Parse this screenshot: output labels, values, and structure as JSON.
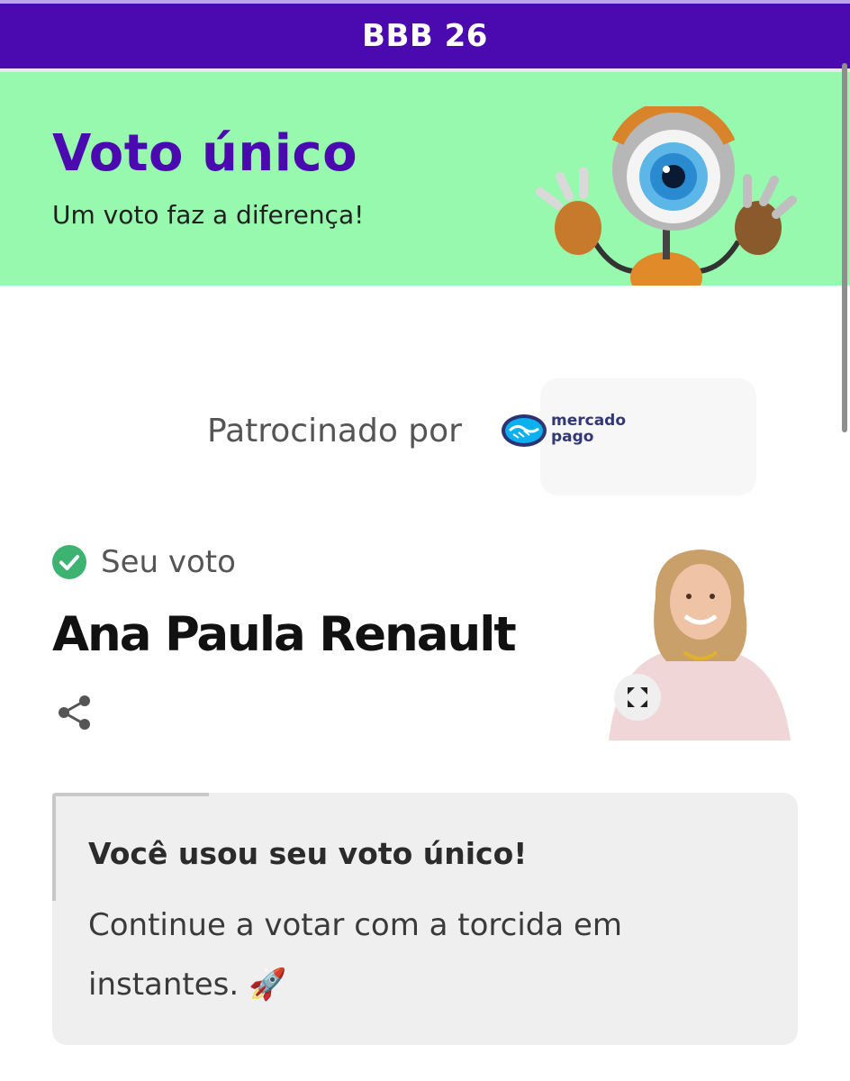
{
  "header": {
    "title": "BBB 26"
  },
  "banner": {
    "title": "Voto único",
    "subtitle": "Um voto faz a diferença!",
    "mascot_icon": "big-brother-eye-mascot"
  },
  "sponsor": {
    "label": "Patrocinado por",
    "logo_line1": "mercado",
    "logo_line2": "pago"
  },
  "vote": {
    "status_label": "Seu voto",
    "candidate_name": "Ana Paula Renault",
    "share_icon": "share-icon",
    "expand_icon": "expand-icon"
  },
  "notice": {
    "title": "Você usou seu voto único!",
    "body": "Continue a votar com a torcida em instantes. 🚀"
  },
  "colors": {
    "header_bg": "#4a0aaf",
    "banner_bg": "#97f9ad",
    "accent_purple": "#4a0aaf",
    "check_green": "#3cb371",
    "card_bg": "#efefef"
  }
}
